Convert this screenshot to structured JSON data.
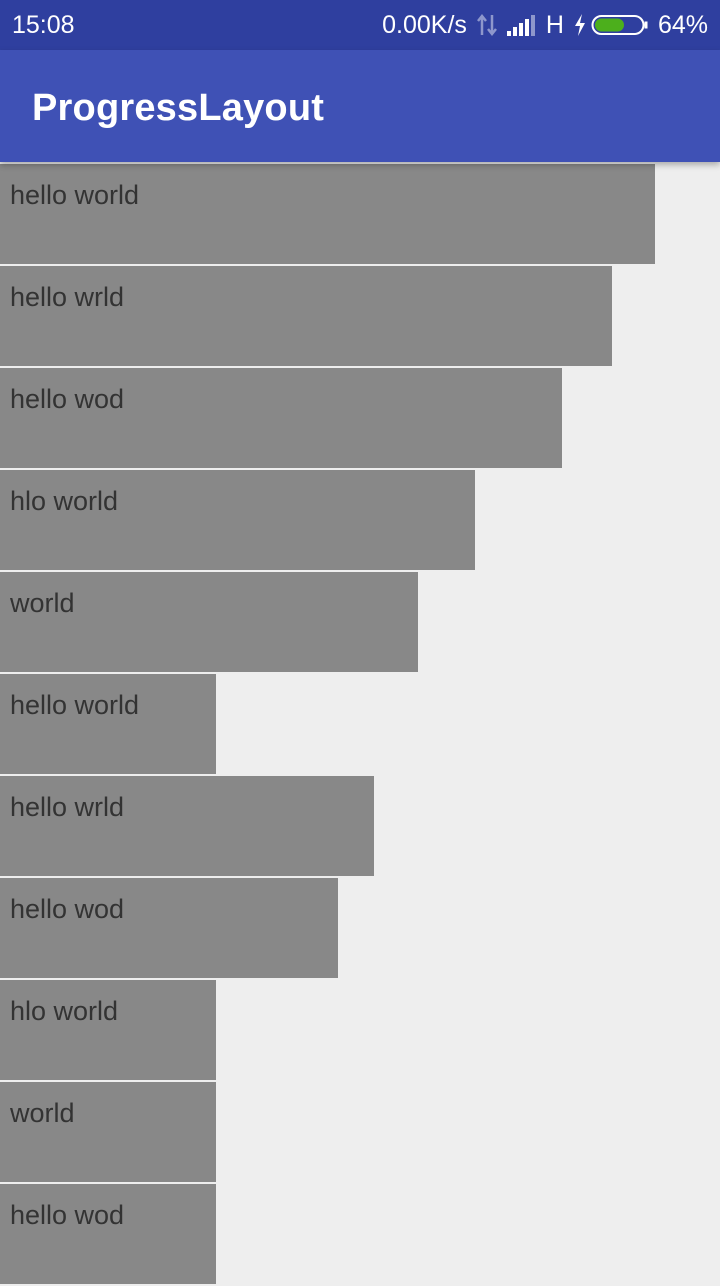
{
  "status_bar": {
    "time": "15:08",
    "net_speed": "0.00K/s",
    "network_type": "H",
    "battery_percent": "64%",
    "battery_level": 0.64,
    "icons": [
      "data-transfer-icon",
      "signal-icon",
      "charging-icon",
      "battery-icon"
    ]
  },
  "app_bar": {
    "title": "ProgressLayout",
    "color": "#3f51b5"
  },
  "colors": {
    "status_bar": "#2f3f9f",
    "background": "#eeeeee",
    "progress_fill": "#888888",
    "label_text": "#333333",
    "battery_fill": "#4caf1c"
  },
  "items": [
    {
      "label": "hello world",
      "progress": 0.91
    },
    {
      "label": "hello wrld",
      "progress": 0.85
    },
    {
      "label": "hello wod",
      "progress": 0.78
    },
    {
      "label": "hlo world",
      "progress": 0.66
    },
    {
      "label": "world",
      "progress": 0.58
    },
    {
      "label": "hello world",
      "progress": 0.3
    },
    {
      "label": "hello wrld",
      "progress": 0.52
    },
    {
      "label": "hello wod",
      "progress": 0.47
    },
    {
      "label": "hlo world",
      "progress": 0.3
    },
    {
      "label": "world",
      "progress": 0.3
    },
    {
      "label": "hello wod",
      "progress": 0.3
    }
  ]
}
